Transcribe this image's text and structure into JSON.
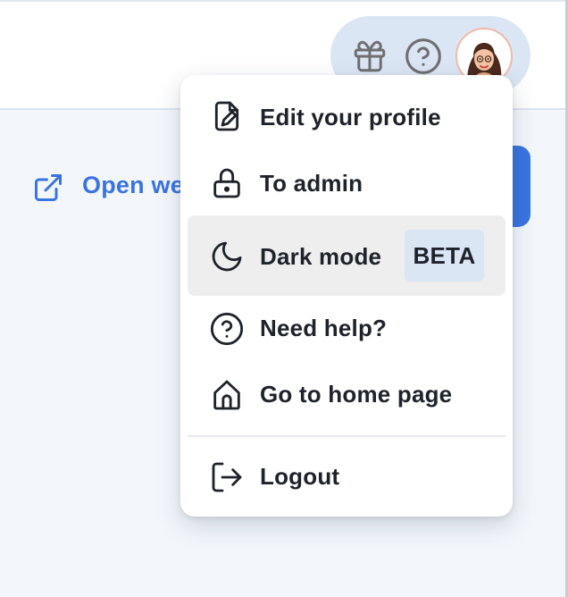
{
  "toolbar": {
    "icons": [
      "gift-icon",
      "help-circle-icon"
    ],
    "avatar_icon": "user-avatar"
  },
  "main": {
    "open_link_label": "Open we",
    "open_link_icon": "external-link-icon"
  },
  "menu": {
    "items": [
      {
        "label": "Edit your profile",
        "icon": "edit-profile-icon"
      },
      {
        "label": "To admin",
        "icon": "lock-icon"
      },
      {
        "label": "Dark mode",
        "icon": "moon-icon",
        "badge": "BETA",
        "highlighted": true
      },
      {
        "label": "Need help?",
        "icon": "help-circle-icon"
      },
      {
        "label": "Go to home page",
        "icon": "home-icon"
      },
      {
        "label": "Logout",
        "icon": "logout-icon"
      }
    ]
  },
  "colors": {
    "accent": "#3a74e0",
    "pill_background": "#dbe6f4",
    "page_background": "#f3f7fc",
    "text": "#1e232b"
  }
}
